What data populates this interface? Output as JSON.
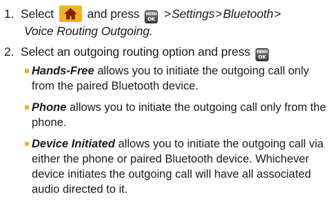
{
  "step1": {
    "number": "1.",
    "select": "Select",
    "and_press": "and press",
    "sep": ">",
    "path1": "Settings",
    "path2": "Bluetooth",
    "path3": "Voice Routing Outgoing."
  },
  "step2": {
    "number": "2.",
    "text": "Select an outgoing routing option and press"
  },
  "menu_key": {
    "top": "MENU",
    "bottom": "OK"
  },
  "options": [
    {
      "term": "Hands-Free",
      "text": " allows you to initiate the outgoing call only from the paired Bluetooth device."
    },
    {
      "term": "Phone",
      "text": " allows you to initiate the outgoing call only from the phone."
    },
    {
      "term": "Device Initiated",
      "text": " allows you to initiate the outgoing call via either the phone or paired Bluetooth device. Whichever device initiates the outgoing call will have all associated audio directed to it."
    }
  ],
  "colors": {
    "accent": "#f3b223",
    "text": "#1a1a1a"
  },
  "icons": {
    "home": "home-icon",
    "menu_ok": "menu-ok-key-icon"
  }
}
